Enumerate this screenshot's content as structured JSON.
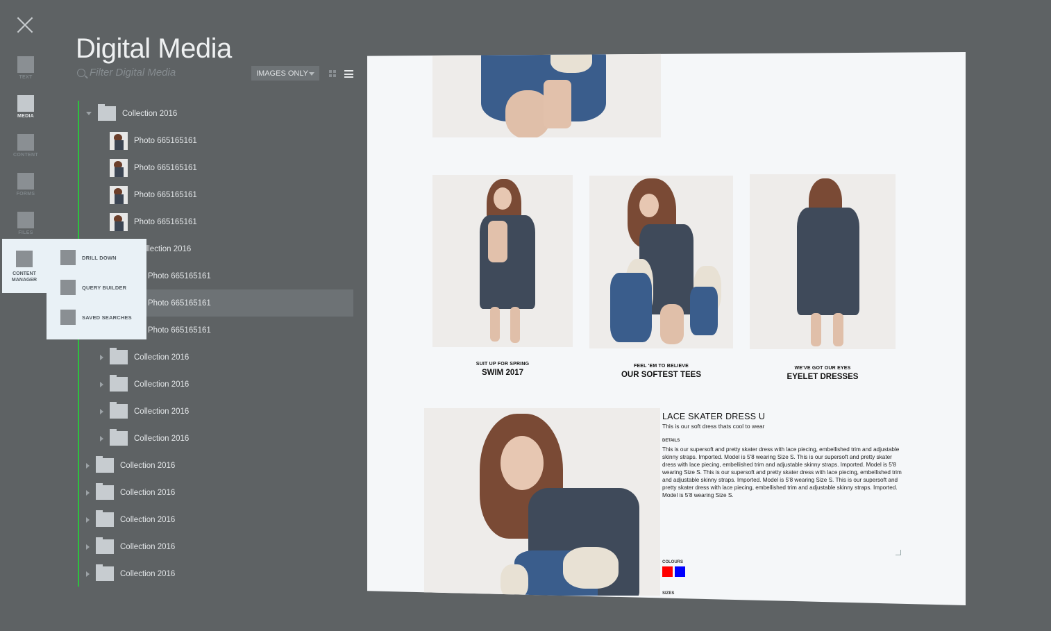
{
  "window": {
    "close_icon": "close-x-icon"
  },
  "rail": {
    "items": [
      {
        "label": "TEXT"
      },
      {
        "label": "MEDIA"
      },
      {
        "label": "CONTENT"
      },
      {
        "label": "FORMS"
      },
      {
        "label": "FILES"
      }
    ]
  },
  "header": {
    "title": "Digital Media",
    "filter_placeholder": "Filter Digital Media",
    "select_value": "IMAGES ONLY"
  },
  "tree": {
    "rows": [
      {
        "label": "Collection 2016",
        "type": "folder",
        "expanded": true
      },
      {
        "label": "Photo 665165161",
        "type": "photo"
      },
      {
        "label": "Photo 665165161",
        "type": "photo"
      },
      {
        "label": "Photo 665165161",
        "type": "photo"
      },
      {
        "label": "Photo 665165161",
        "type": "photo"
      },
      {
        "label": "Collection 2016",
        "type": "folder",
        "expanded": true
      },
      {
        "label": "Photo 665165161",
        "type": "photo"
      },
      {
        "label": "Photo 665165161",
        "type": "photo",
        "selected": true
      },
      {
        "label": "Photo 665165161",
        "type": "photo"
      },
      {
        "label": "Collection 2016",
        "type": "folder"
      },
      {
        "label": "Collection 2016",
        "type": "folder"
      },
      {
        "label": "Collection 2016",
        "type": "folder"
      },
      {
        "label": "Collection 2016",
        "type": "folder"
      },
      {
        "label": "Collection 2016",
        "type": "folder"
      },
      {
        "label": "Collection 2016",
        "type": "folder"
      },
      {
        "label": "Collection 2016",
        "type": "folder"
      },
      {
        "label": "Collection 2016",
        "type": "folder"
      },
      {
        "label": "Collection 2016",
        "type": "folder"
      }
    ]
  },
  "content_manager": {
    "label_line1": "CONTENT",
    "label_line2": "MANAGER",
    "items": [
      {
        "label": "DRILL DOWN"
      },
      {
        "label": "QUERY BUILDER"
      },
      {
        "label": "SAVED SEARCHES"
      }
    ]
  },
  "preview": {
    "captions": [
      {
        "small": "SUIT UP FOR SPRING",
        "big": "SWIM 2017"
      },
      {
        "small": "FEEL 'EM TO BELIEVE",
        "big": "OUR SOFTEST TEES"
      },
      {
        "small": "WE'VE GOT OUR EYES",
        "big": "EYELET DRESSES"
      }
    ],
    "product": {
      "title": "LACE SKATER DRESS U",
      "subtitle": "This is our soft dress thats cool to wear",
      "details_label": "DETAILS",
      "details": "This is our supersoft and pretty skater dress with lace piecing, embellished trim and adjustable skinny straps. Imported. Model is 5'8 wearing Size S. This is our supersoft and pretty skater dress with lace piecing, embellished trim and adjustable skinny straps. Imported. Model is 5'8 wearing Size S. This is our supersoft and pretty skater dress with lace piecing, embellished trim and adjustable skinny straps. Imported. Model is 5'8 wearing Size S. This is our supersoft and pretty skater dress with lace piecing, embellished trim and adjustable skinny straps. Imported. Model is 5'8 wearing Size S.",
      "colours_label": "COLOURS",
      "colours": [
        "#ff0000",
        "#0000ff"
      ],
      "sizes_label": "SIZES"
    }
  }
}
